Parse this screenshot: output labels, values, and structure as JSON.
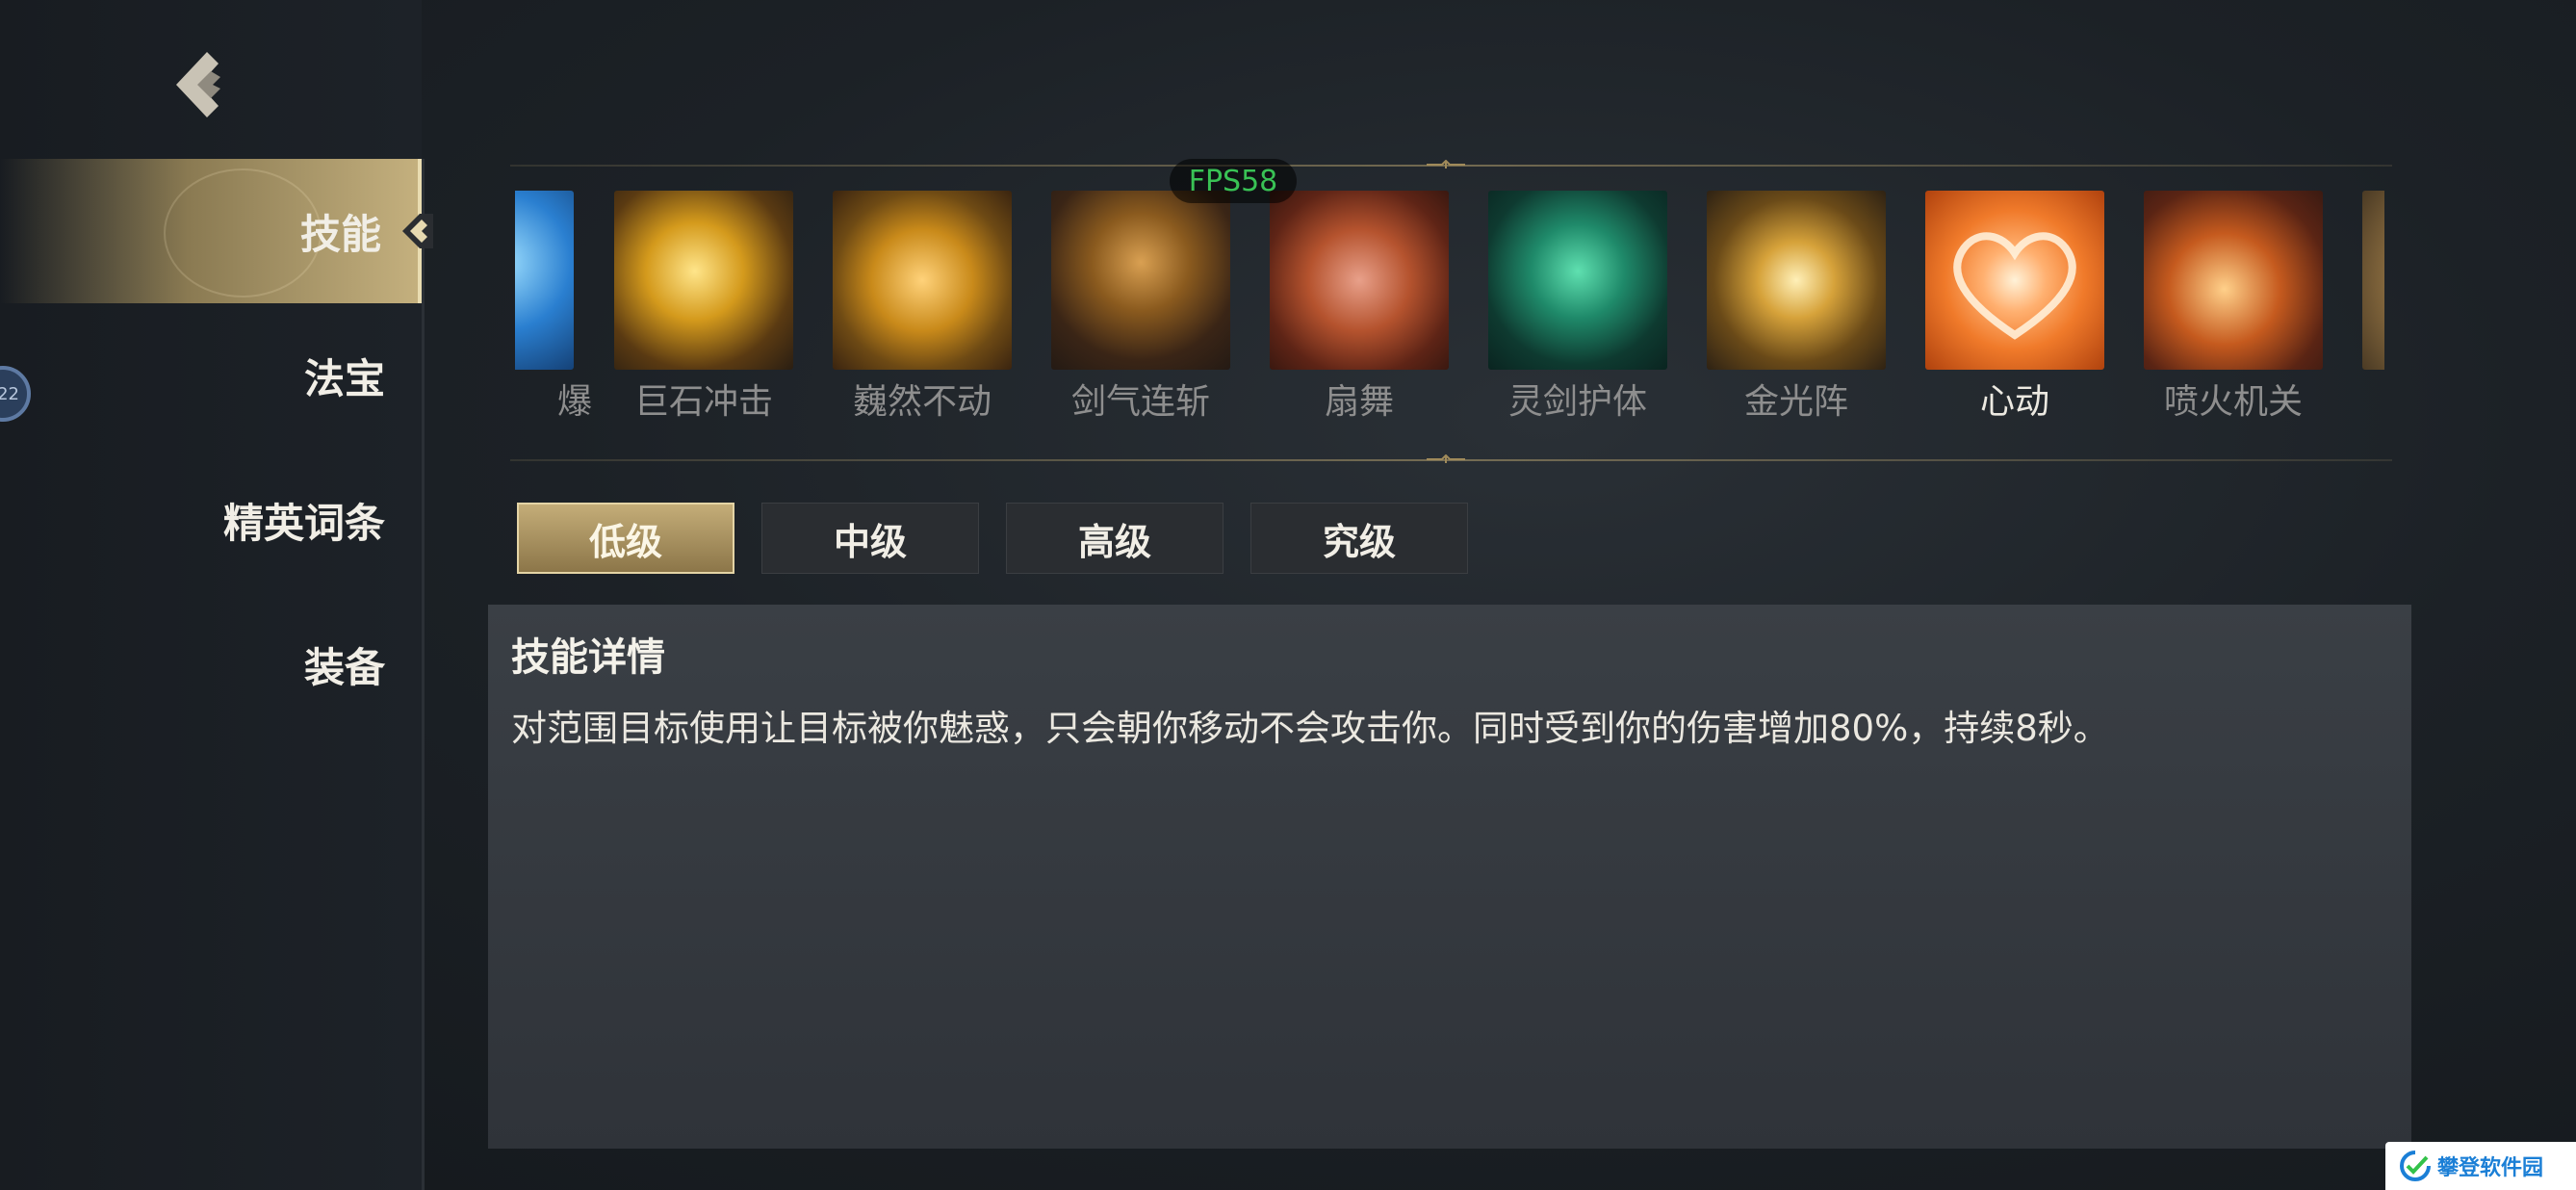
{
  "sidebar": {
    "items": [
      {
        "label": "技能",
        "active": true
      },
      {
        "label": "法宝",
        "active": false
      },
      {
        "label": "精英词条",
        "active": false
      },
      {
        "label": "装备",
        "active": false
      }
    ],
    "badge_text": "22"
  },
  "fps": "FPS58",
  "skills": [
    {
      "label": "爆",
      "icon": "ice-blast-icon",
      "color": "#2a7fd0"
    },
    {
      "label": "巨石冲击",
      "icon": "boulder-impact-icon",
      "color": "#d49a1c"
    },
    {
      "label": "巍然不动",
      "icon": "golden-shield-icon",
      "color": "#c98a1a"
    },
    {
      "label": "剑气连斩",
      "icon": "sword-slash-icon",
      "color": "#8a5a1e"
    },
    {
      "label": "扇舞",
      "icon": "fan-dance-icon",
      "color": "#b5532e"
    },
    {
      "label": "灵剑护体",
      "icon": "spirit-swords-icon",
      "color": "#1f8a6a"
    },
    {
      "label": "金光阵",
      "icon": "golden-array-icon",
      "color": "#d6a23a"
    },
    {
      "label": "心动",
      "icon": "heart-icon",
      "color": "#f07a2a",
      "selected": true
    },
    {
      "label": "喷火机关",
      "icon": "flamethrower-icon",
      "color": "#c55a1e"
    },
    {
      "label": "",
      "icon": "partial-skill-icon",
      "color": "#b08a50"
    }
  ],
  "tiers": [
    {
      "label": "低级",
      "active": true
    },
    {
      "label": "中级",
      "active": false
    },
    {
      "label": "高级",
      "active": false
    },
    {
      "label": "究级",
      "active": false
    }
  ],
  "details": {
    "title": "技能详情",
    "text": "对范围目标使用让目标被你魅惑，只会朝你移动不会攻击你。同时受到你的伤害增加80%，持续8秒。"
  },
  "watermark": "攀登软件园"
}
